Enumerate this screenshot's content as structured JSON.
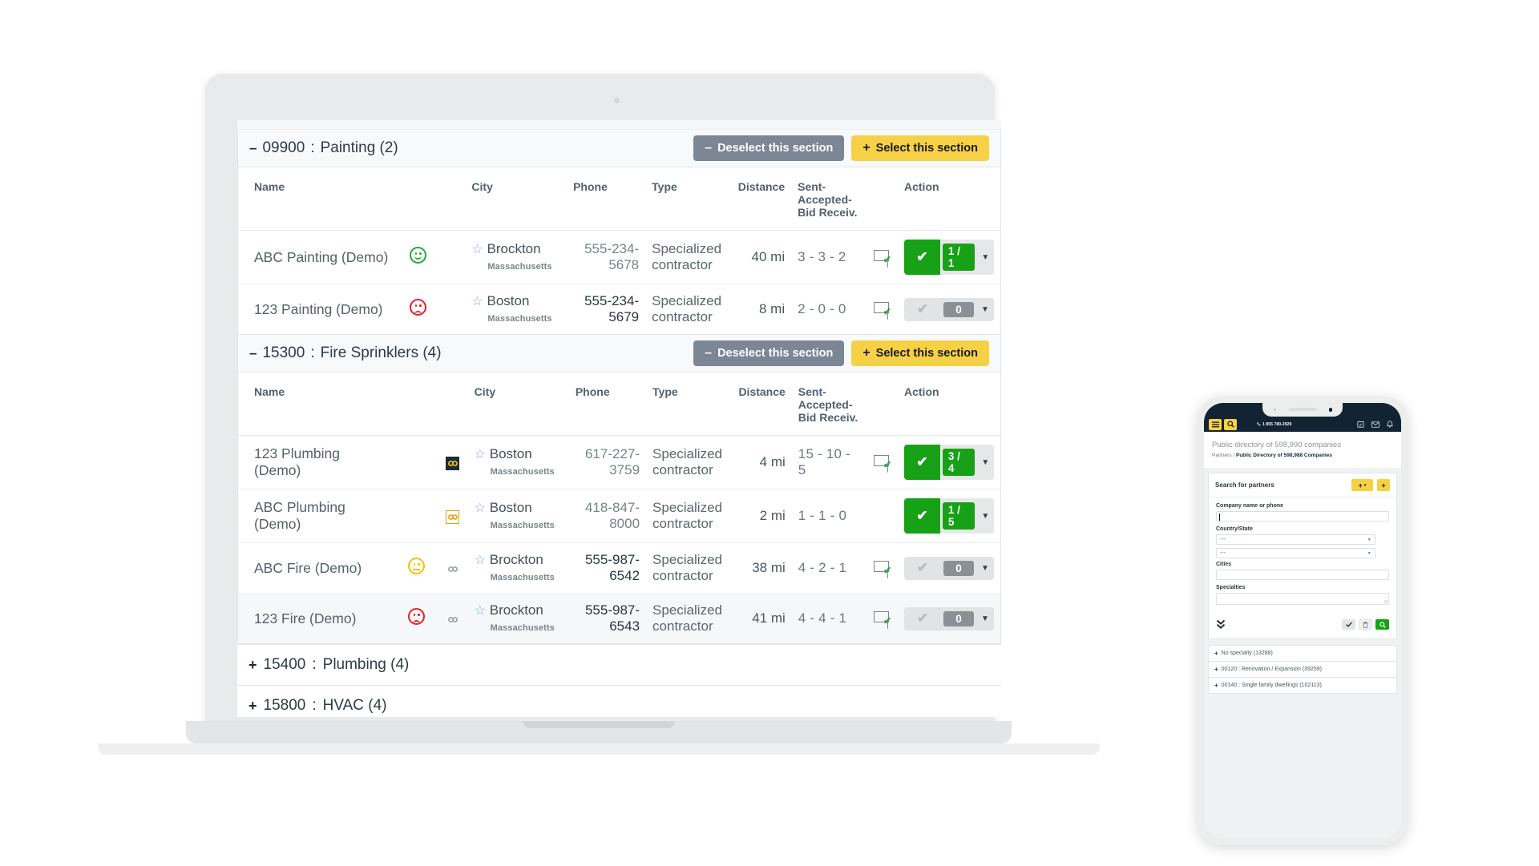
{
  "laptop": {
    "sections": [
      {
        "sign": "–",
        "code": "09900",
        "sep": ":",
        "name": "Painting (2)",
        "deselect_label": "Deselect this section",
        "deselect_sign": "–",
        "select_label": "Select this section",
        "select_sign": "+",
        "columns": [
          "Name",
          "City",
          "Phone",
          "Type",
          "Distance",
          "Sent-Accepted-",
          "Bid Receiv.",
          "Action"
        ],
        "rows": [
          {
            "name": "ABC Painting (Demo)",
            "mood": "happy-green",
            "link": "none",
            "city": "Brockton",
            "state": "Massachusetts",
            "phone": "555-234-5678",
            "phone_style": "light",
            "type": "Specialized contractor",
            "distance": "40 mi",
            "sab": "3 - 3 - 2",
            "mail": "envelope-check-icon",
            "action_state": "on",
            "action_badge": "1 / 1"
          },
          {
            "name": "123 Painting (Demo)",
            "mood": "sad-red",
            "link": "none",
            "city": "Boston",
            "state": "Massachusetts",
            "phone": "555-234-5679",
            "phone_style": "dark",
            "type": "Specialized contractor",
            "distance": "8 mi",
            "sab": "2 - 0 - 0",
            "mail": "envelope-check-icon",
            "action_state": "off",
            "action_badge": "0"
          }
        ]
      },
      {
        "sign": "–",
        "code": "15300",
        "sep": ":",
        "name": "Fire Sprinklers (4)",
        "deselect_label": "Deselect this section",
        "deselect_sign": "–",
        "select_label": "Select this section",
        "select_sign": "+",
        "columns": [
          "Name",
          "City",
          "Phone",
          "Type",
          "Distance",
          "Sent-Accepted-",
          "Bid Receiv.",
          "Action"
        ],
        "rows": [
          {
            "name": "123 Plumbing (Demo)",
            "mood": "none",
            "link": "badge-dark",
            "city": "Boston",
            "state": "Massachusetts",
            "phone": "617-227-3759",
            "phone_style": "light",
            "type": "Specialized contractor",
            "distance": "4 mi",
            "sab": "15 - 10 - 5",
            "mail": "envelope-check-icon",
            "action_state": "on",
            "action_badge": "3 / 4"
          },
          {
            "name": "ABC Plumbing (Demo)",
            "mood": "none",
            "link": "badge-light",
            "city": "Boston",
            "state": "Massachusetts",
            "phone": "418-847-8000",
            "phone_style": "light",
            "type": "Specialized contractor",
            "distance": "2 mi",
            "sab": "1 - 1 - 0",
            "mail": "none",
            "action_state": "on",
            "action_badge": "1 / 5"
          },
          {
            "name": "ABC Fire (Demo)",
            "mood": "neutral-yellow",
            "link": "plain",
            "city": "Brockton",
            "state": "Massachusetts",
            "phone": "555-987-6542",
            "phone_style": "dark",
            "type": "Specialized contractor",
            "distance": "38 mi",
            "sab": "4 - 2 - 1",
            "mail": "envelope-check-icon",
            "action_state": "off",
            "action_badge": "0"
          },
          {
            "name": "123 Fire (Demo)",
            "mood": "sad-red",
            "link": "plain",
            "city": "Brockton",
            "state": "Massachusetts",
            "phone": "555-987-6543",
            "phone_style": "dark",
            "type": "Specialized contractor",
            "distance": "41 mi",
            "sab": "4 - 4 - 1",
            "mail": "envelope-check-icon",
            "action_state": "off",
            "action_badge": "0",
            "highlighted": true
          }
        ]
      }
    ],
    "collapsed_sections": [
      {
        "sign": "+",
        "code": "15400",
        "sep": ":",
        "name": "Plumbing (4)"
      },
      {
        "sign": "+",
        "code": "15800",
        "sep": ":",
        "name": "HVAC (4)"
      }
    ]
  },
  "phone": {
    "topbar": {
      "menu_icon": "hamburger-icon",
      "search_icon": "search-icon",
      "phone_number": "1 855 780-2929",
      "phone_icon": "telephone-icon",
      "calendar_icon": "calendar-check-icon",
      "mail_icon": "envelope-icon",
      "bell_icon": "bell-icon"
    },
    "page_title": "Public directory of 598,990 companies",
    "breadcrumb_parent": "Partners",
    "breadcrumb_sep": " / ",
    "breadcrumb_current": "Public Directory of 598,988 Companies",
    "search_panel": {
      "title": "Search for partners",
      "btn_add_menu": "+",
      "btn_add_menu_caret": "▾",
      "btn_add": "+",
      "fields": [
        {
          "label": "Company name or phone",
          "kind": "text",
          "value": ""
        },
        {
          "label": "Country/State",
          "kind": "select",
          "value": "---"
        },
        {
          "label": "",
          "kind": "select",
          "value": "---"
        },
        {
          "label": "Cities",
          "kind": "text",
          "value": ""
        },
        {
          "label": "Specialties",
          "kind": "textarea",
          "value": ""
        }
      ],
      "footer": {
        "expand_icon": "chevron-double-down-icon",
        "apply_icon": "check-icon",
        "clear_icon": "trash-icon",
        "search_icon": "search-icon"
      }
    },
    "specialty_list": [
      {
        "sign": "+",
        "label": "No specialty (13288)"
      },
      {
        "sign": "+",
        "label": "00120 : Renovation / Expansion (39259)"
      },
      {
        "sign": "+",
        "label": "00140 : Single family dwellings (102113)"
      }
    ]
  },
  "cursor": {
    "icon": "pointing-hand-cursor"
  }
}
